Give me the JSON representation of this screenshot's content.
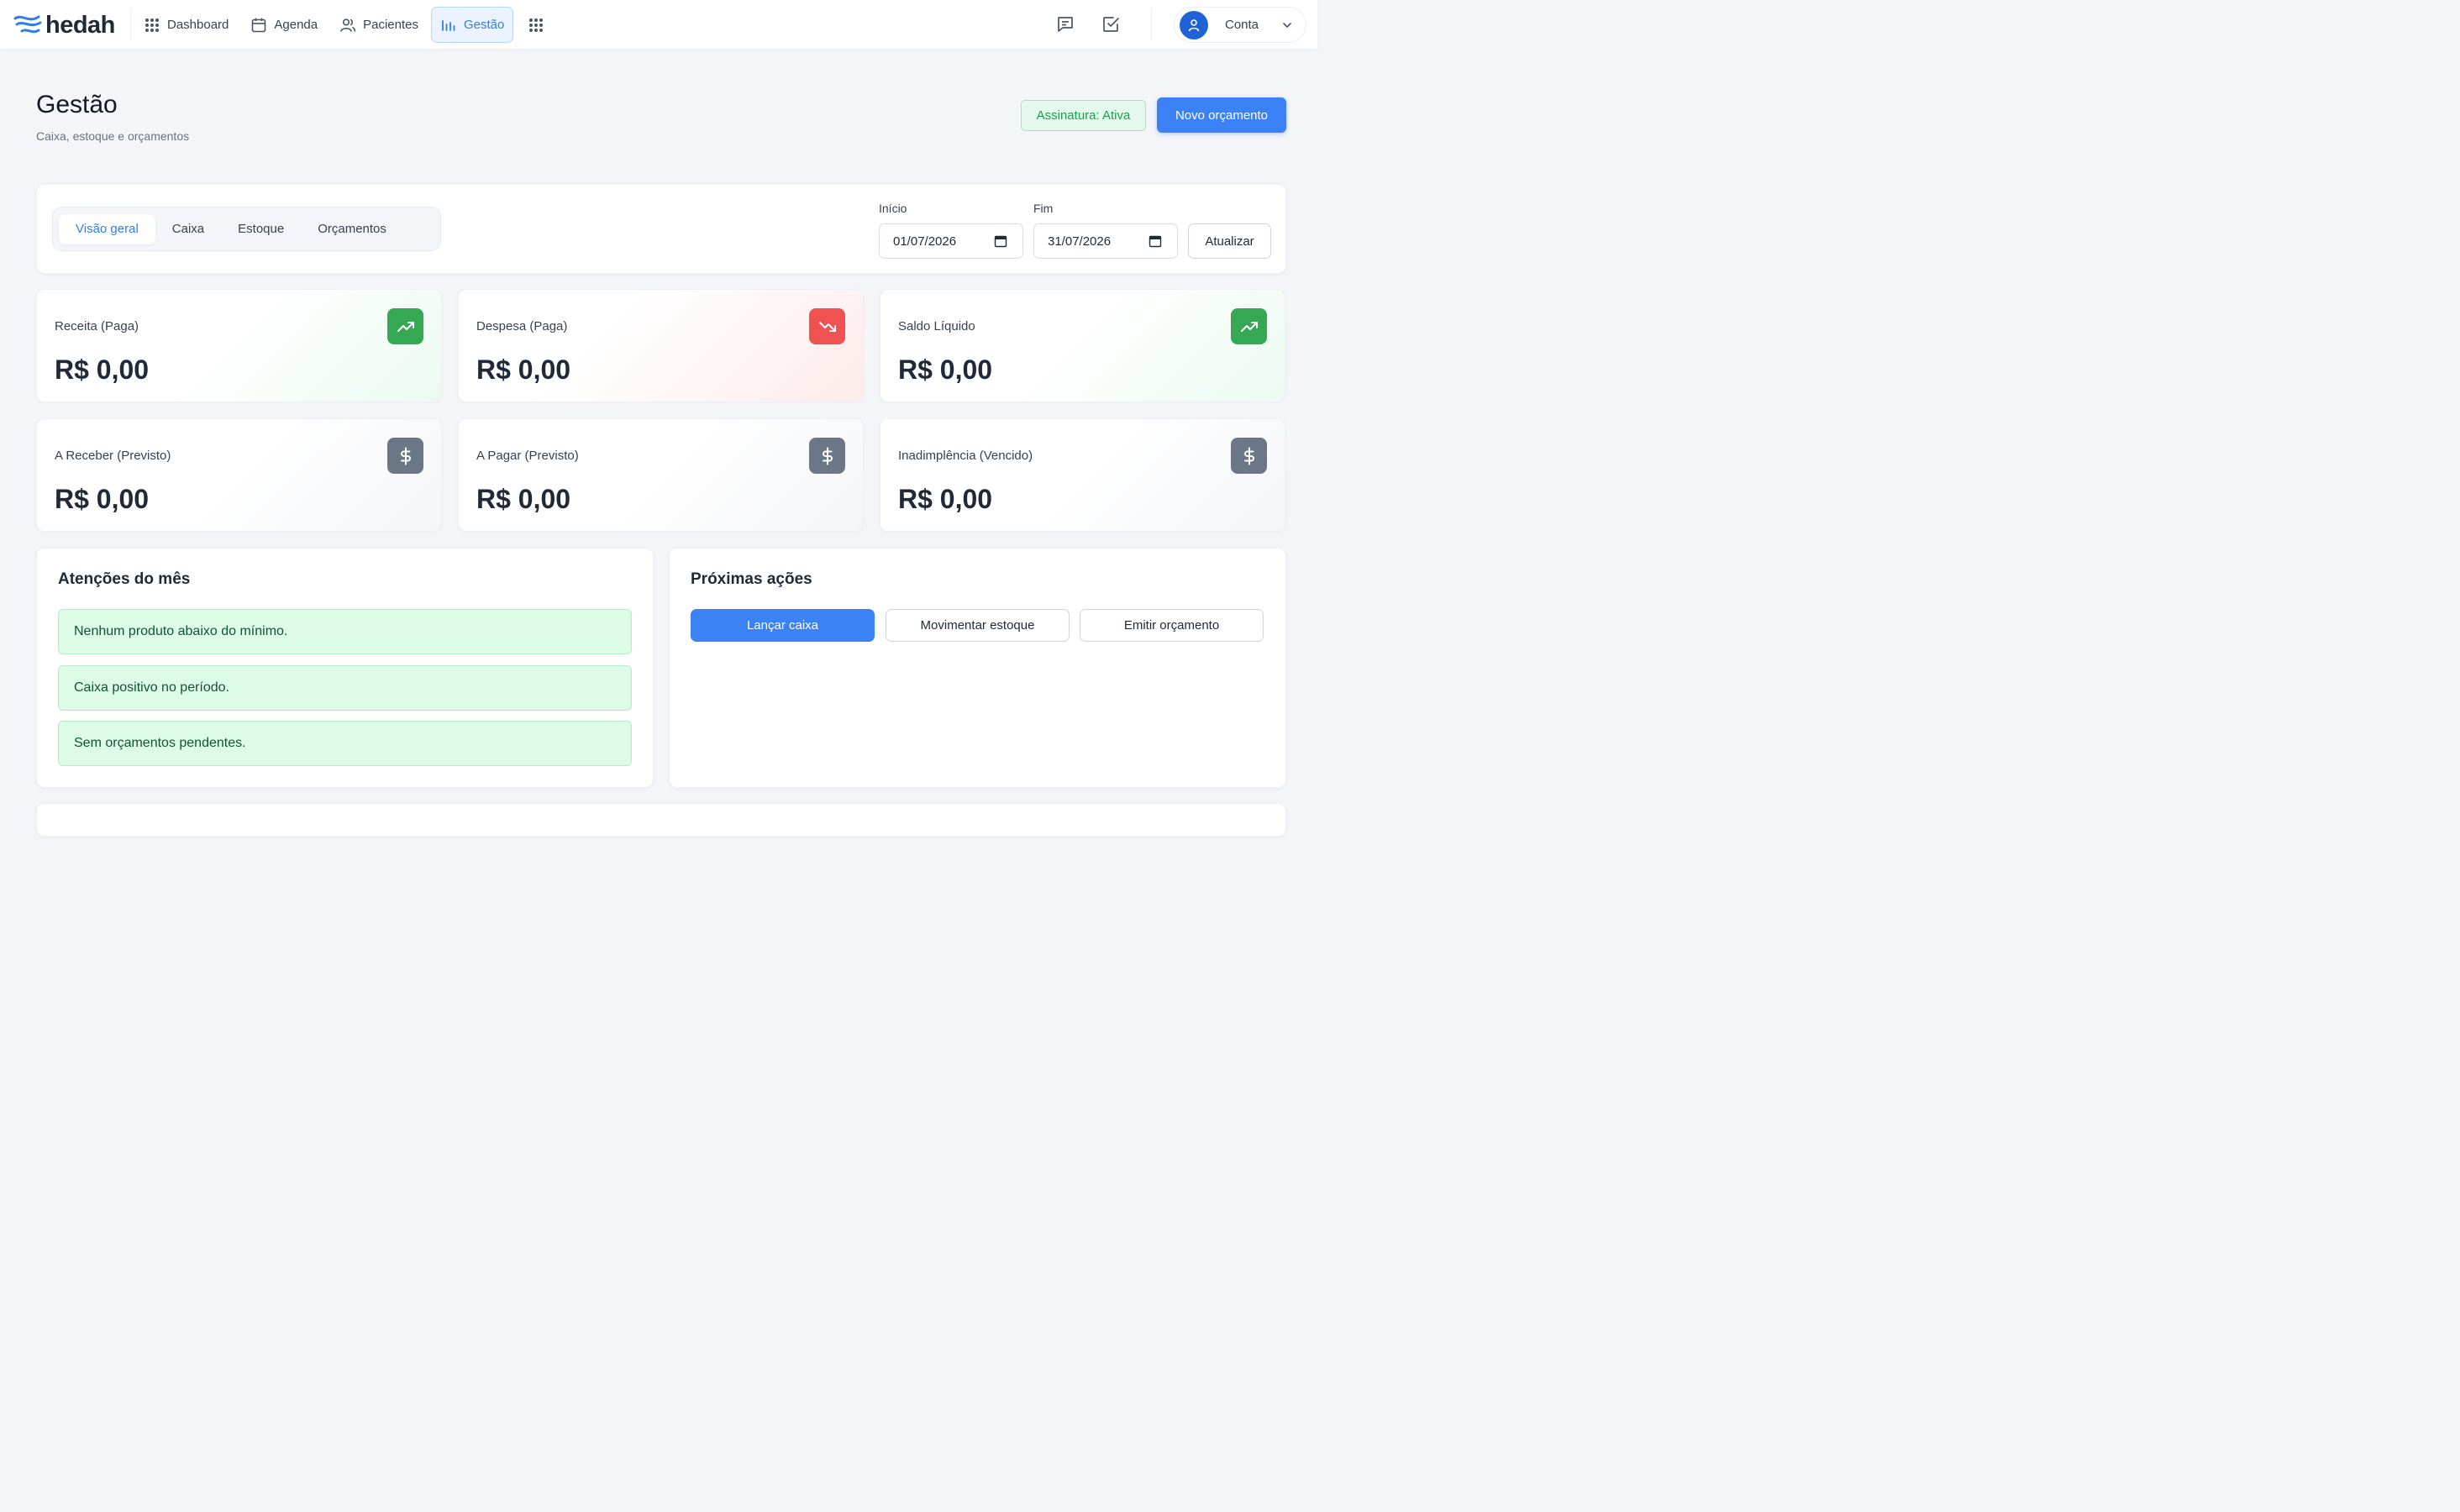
{
  "brand": {
    "name": "hedah"
  },
  "nav": {
    "items": [
      {
        "label": "Dashboard",
        "icon": "dashboard-grid-icon"
      },
      {
        "label": "Agenda",
        "icon": "calendar-icon"
      },
      {
        "label": "Pacientes",
        "icon": "users-icon"
      },
      {
        "label": "Gestão",
        "icon": "bar-chart-icon",
        "active": true
      }
    ],
    "more_icon": "apps-grid-icon"
  },
  "header_actions": {
    "messages_icon": "message-square-icon",
    "tasks_icon": "check-square-icon",
    "account_label": "Conta"
  },
  "page": {
    "title": "Gestão",
    "subtitle": "Caixa, estoque e orçamentos",
    "subscription_badge": "Assinatura: Ativa",
    "new_quote_button": "Novo orçamento"
  },
  "filters": {
    "tabs": [
      "Visão geral",
      "Caixa",
      "Estoque",
      "Orçamentos"
    ],
    "active_tab": "Visão geral",
    "start_label": "Início",
    "start_value": "01/07/2026",
    "end_label": "Fim",
    "end_value": "31/07/2026",
    "refresh_button": "Atualizar"
  },
  "stats": [
    {
      "label": "Receita (Paga)",
      "value": "R$ 0,00",
      "icon": "trending-up-icon",
      "color": "#34a853"
    },
    {
      "label": "Despesa (Paga)",
      "value": "R$ 0,00",
      "icon": "trending-down-icon",
      "color": "#f05252"
    },
    {
      "label": "Saldo Líquido",
      "value": "R$ 0,00",
      "icon": "trending-up-icon",
      "color": "#34a853"
    },
    {
      "label": "A Receber (Previsto)",
      "value": "R$ 0,00",
      "icon": "dollar-icon",
      "color": "#6b7787"
    },
    {
      "label": "A Pagar (Previsto)",
      "value": "R$ 0,00",
      "icon": "dollar-icon",
      "color": "#6b7787"
    },
    {
      "label": "Inadimplência (Vencido)",
      "value": "R$ 0,00",
      "icon": "dollar-icon",
      "color": "#6b7787"
    }
  ],
  "attention": {
    "title": "Atenções do mês",
    "items": [
      "Nenhum produto abaixo do mínimo.",
      "Caixa positivo no período.",
      "Sem orçamentos pendentes."
    ]
  },
  "next_actions": {
    "title": "Próximas ações",
    "buttons": [
      "Lançar caixa",
      "Movimentar estoque",
      "Emitir orçamento"
    ]
  },
  "colors": {
    "accent": "#3b82f6",
    "success": "#34a853",
    "danger": "#f05252",
    "neutral_icon": "#6b7787"
  }
}
